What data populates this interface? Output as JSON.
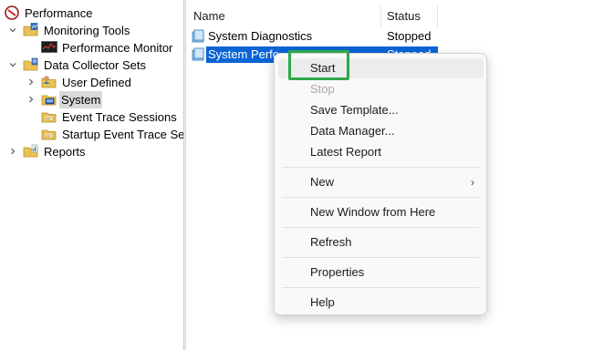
{
  "tree": {
    "root": "Performance",
    "monitoring_tools": "Monitoring Tools",
    "performance_monitor": "Performance Monitor",
    "data_collector_sets": "Data Collector Sets",
    "user_defined": "User Defined",
    "system": "System",
    "event_trace_sessions": "Event Trace Sessions",
    "startup_event_trace_sessions": "Startup Event Trace Sess",
    "reports": "Reports"
  },
  "list": {
    "columns": {
      "name": "Name",
      "status": "Status"
    },
    "rows": [
      {
        "name": "System Diagnostics",
        "status": "Stopped"
      },
      {
        "name": "System Perfo",
        "status": "Stopped"
      }
    ]
  },
  "context_menu": {
    "items": [
      {
        "label": "Start",
        "state": "hover"
      },
      {
        "label": "Stop",
        "state": "disabled"
      },
      {
        "label": "Save Template...",
        "state": "normal"
      },
      {
        "label": "Data Manager...",
        "state": "normal"
      },
      {
        "label": "Latest Report",
        "state": "normal"
      },
      {
        "label": "New",
        "state": "submenu"
      },
      {
        "label": "New Window from Here",
        "state": "normal"
      },
      {
        "label": "Refresh",
        "state": "normal"
      },
      {
        "label": "Properties",
        "state": "normal"
      },
      {
        "label": "Help",
        "state": "normal"
      }
    ],
    "submenu_glyph": "›"
  },
  "colors": {
    "selection": "#0a64d6",
    "menu_background": "#f9f9f9",
    "annotation_border": "#2ea84a",
    "disabled_text": "#a8a8a8"
  }
}
